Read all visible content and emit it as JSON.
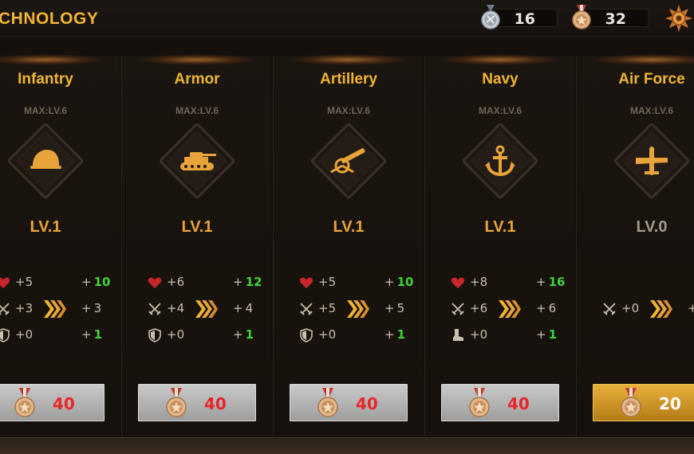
{
  "header": {
    "title": "CHNOLOGY",
    "silver_medals": "16",
    "bronze_medals": "32",
    "settings_icon": "gear-icon"
  },
  "colors": {
    "title_gold": "#f0b531",
    "stat_green": "#3fd23b",
    "cost_red": "#e8262a",
    "button_gray": "#b5b5b5",
    "button_gold": "#d39a2b"
  },
  "cards": [
    {
      "name": "Infantry",
      "max": "MAX:LV.6",
      "level": "LV.1",
      "emblem": "helmet-icon",
      "stats": [
        {
          "icon": "heart-icon",
          "value": "+5",
          "next": "+",
          "next_value": "10",
          "highlight": true
        },
        {
          "icon": "swords-icon",
          "value": "+3",
          "next": "+",
          "next_value": "3",
          "highlight": false
        },
        {
          "icon": "shield-icon",
          "value": "+0",
          "next": "+",
          "next_value": "1",
          "highlight": true
        }
      ],
      "cost": "40",
      "affordable": false
    },
    {
      "name": "Armor",
      "max": "MAX:LV.6",
      "level": "LV.1",
      "emblem": "tank-icon",
      "stats": [
        {
          "icon": "heart-icon",
          "value": "+6",
          "next": "+",
          "next_value": "12",
          "highlight": true
        },
        {
          "icon": "swords-icon",
          "value": "+4",
          "next": "+",
          "next_value": "4",
          "highlight": false
        },
        {
          "icon": "shield-icon",
          "value": "+0",
          "next": "+",
          "next_value": "1",
          "highlight": true
        }
      ],
      "cost": "40",
      "affordable": false
    },
    {
      "name": "Artillery",
      "max": "MAX:LV.6",
      "level": "LV.1",
      "emblem": "cannon-icon",
      "stats": [
        {
          "icon": "heart-icon",
          "value": "+5",
          "next": "+",
          "next_value": "10",
          "highlight": true
        },
        {
          "icon": "swords-icon",
          "value": "+5",
          "next": "+",
          "next_value": "5",
          "highlight": false
        },
        {
          "icon": "shield-icon",
          "value": "+0",
          "next": "+",
          "next_value": "1",
          "highlight": true
        }
      ],
      "cost": "40",
      "affordable": false
    },
    {
      "name": "Navy",
      "max": "MAX:LV.6",
      "level": "LV.1",
      "emblem": "anchor-icon",
      "stats": [
        {
          "icon": "heart-icon",
          "value": "+8",
          "next": "+",
          "next_value": "16",
          "highlight": true
        },
        {
          "icon": "swords-icon",
          "value": "+6",
          "next": "+",
          "next_value": "6",
          "highlight": false
        },
        {
          "icon": "boot-icon",
          "value": "+0",
          "next": "+",
          "next_value": "1",
          "highlight": true
        }
      ],
      "cost": "40",
      "affordable": false
    },
    {
      "name": "Air Force",
      "max": "MAX:LV.6",
      "level": "LV.0",
      "emblem": "plane-icon",
      "stats": [
        {
          "icon": "swords-icon",
          "value": "+0",
          "next": "+",
          "next_value": "",
          "highlight": false
        }
      ],
      "cost": "20",
      "affordable": true
    }
  ]
}
